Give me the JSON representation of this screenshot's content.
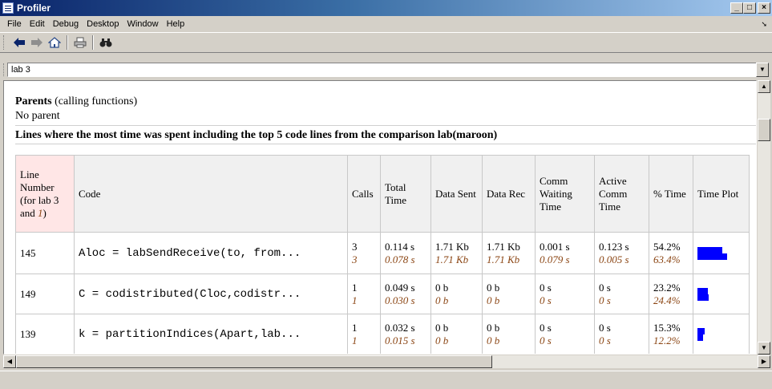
{
  "window": {
    "title": "Profiler",
    "min": "_",
    "max": "□",
    "close": "×"
  },
  "menu": [
    "File",
    "Edit",
    "Debug",
    "Desktop",
    "Window",
    "Help"
  ],
  "address": {
    "value": "lab 3"
  },
  "content": {
    "parents_label": "Parents",
    "parents_suffix": " (calling functions)",
    "no_parent": "No parent",
    "lines_heading": "Lines where the most time was spent including the top 5 code lines from the comparison lab(maroon)"
  },
  "table": {
    "headers": {
      "line_a": "Line",
      "line_b": "Number",
      "line_c": "(for lab 3",
      "line_d": "and ",
      "line_d_num": "1",
      "line_d_end": ")",
      "code": "Code",
      "calls": "Calls",
      "total_time": "Total Time",
      "data_sent": "Data Sent",
      "data_rec": "Data Rec",
      "comm_waiting": "Comm Waiting Time",
      "active_comm": "Active Comm Time",
      "pct_time": "% Time",
      "time_plot": "Time Plot"
    },
    "rows": [
      {
        "line": "145",
        "code": "Aloc = labSendReceive(to, from...",
        "calls": "3",
        "calls_cmp": "3",
        "total": "0.114 s",
        "total_cmp": "0.078 s",
        "sent": "1.71 Kb",
        "sent_cmp": "1.71 Kb",
        "rec": "1.71 Kb",
        "rec_cmp": "1.71 Kb",
        "wait": "0.001 s",
        "wait_cmp": "0.079 s",
        "active": "0.123 s",
        "active_cmp": "0.005 s",
        "pct": "54.2%",
        "pct_cmp": "63.4%",
        "bar_frac": 0.542,
        "bar_cmp_frac": 0.634
      },
      {
        "line": "149",
        "code": "C = codistributed(Cloc,codistr...",
        "calls": "1",
        "calls_cmp": "1",
        "total": "0.049 s",
        "total_cmp": "0.030 s",
        "sent": "0 b",
        "sent_cmp": "0 b",
        "rec": "0 b",
        "rec_cmp": "0 b",
        "wait": "0 s",
        "wait_cmp": "0 s",
        "active": "0 s",
        "active_cmp": "0 s",
        "pct": "23.2%",
        "pct_cmp": "24.4%",
        "bar_frac": 0.232,
        "bar_cmp_frac": 0.244
      },
      {
        "line": "139",
        "code": "k = partitionIndices(Apart,lab...",
        "calls": "1",
        "calls_cmp": "1",
        "total": "0.032 s",
        "total_cmp": "0.015 s",
        "sent": "0 b",
        "sent_cmp": "0 b",
        "rec": "0 b",
        "rec_cmp": "0 b",
        "wait": "0 s",
        "wait_cmp": "0 s",
        "active": "0 s",
        "active_cmp": "0 s",
        "pct": "15.3%",
        "pct_cmp": "12.2%",
        "bar_frac": 0.153,
        "bar_cmp_frac": 0.122
      }
    ]
  }
}
